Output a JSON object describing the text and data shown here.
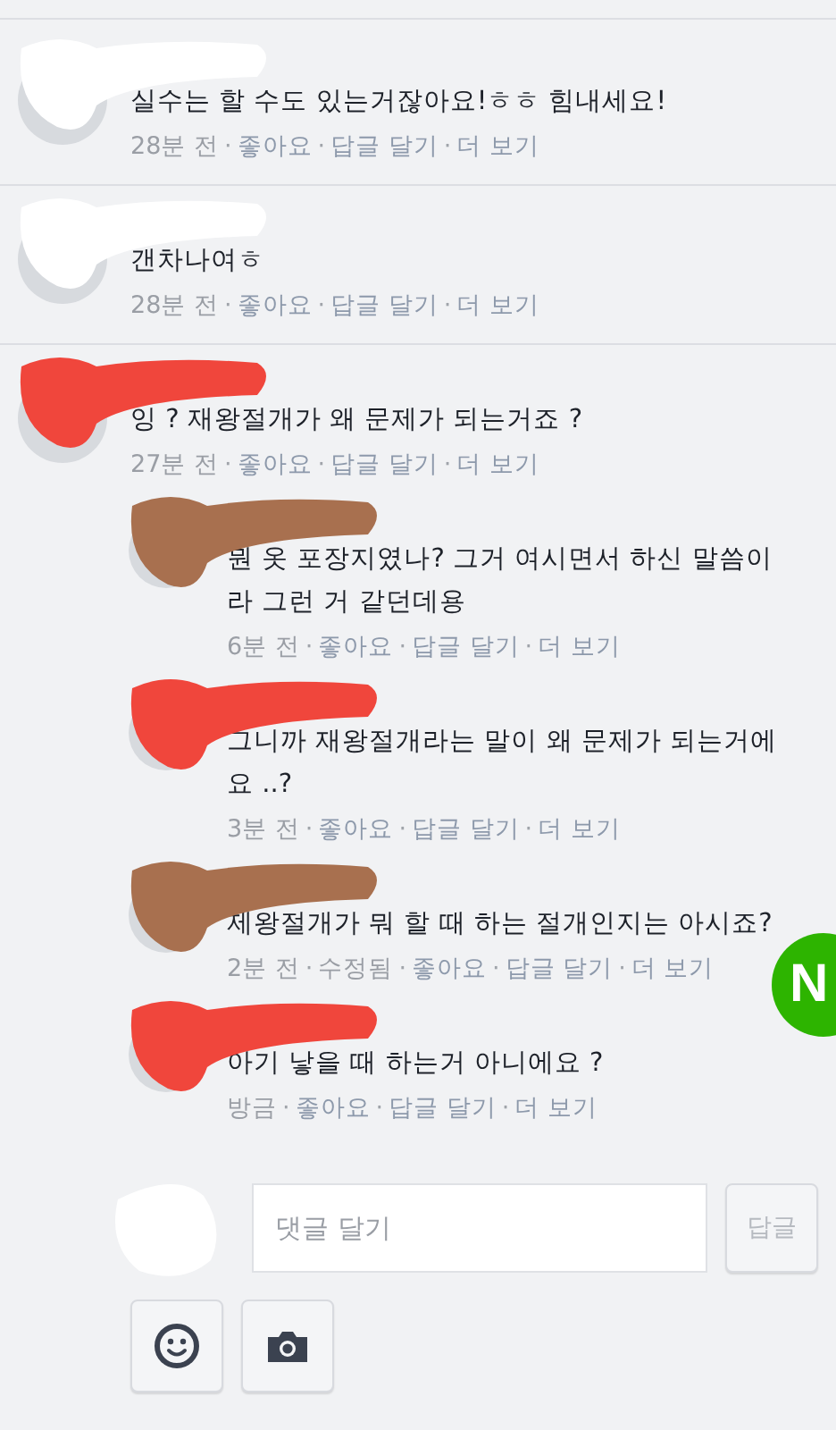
{
  "meta_separator": "·",
  "comments": [
    {
      "text": "실수는 할 수도 있는거잖아요!ㅎㅎ 힘내세요!",
      "color": "#ffffff",
      "meta": [
        {
          "kind": "time",
          "text": "28분 전"
        },
        {
          "kind": "link",
          "text": "좋아요"
        },
        {
          "kind": "link",
          "text": "답글 달기"
        },
        {
          "kind": "link",
          "text": "더 보기"
        }
      ]
    },
    {
      "text": "갠차나여ㅎ",
      "color": "#ffffff",
      "meta": [
        {
          "kind": "time",
          "text": "28분 전"
        },
        {
          "kind": "link",
          "text": "좋아요"
        },
        {
          "kind": "link",
          "text": "답글 달기"
        },
        {
          "kind": "link",
          "text": "더 보기"
        }
      ]
    },
    {
      "text": "잉 ? 재왕절개가 왜 문제가 되는거죠 ?",
      "color": "#f0463c",
      "meta": [
        {
          "kind": "time",
          "text": "27분 전"
        },
        {
          "kind": "link",
          "text": "좋아요"
        },
        {
          "kind": "link",
          "text": "답글 달기"
        },
        {
          "kind": "link",
          "text": "더 보기"
        }
      ],
      "replies": [
        {
          "text": "뭔 옷 포장지였나? 그거 여시면서 하신 말씀이라 그런 거 같던데용",
          "color": "#a8704f",
          "meta": [
            {
              "kind": "time",
              "text": "6분 전"
            },
            {
              "kind": "link",
              "text": "좋아요"
            },
            {
              "kind": "link",
              "text": "답글 달기"
            },
            {
              "kind": "link",
              "text": "더 보기"
            }
          ]
        },
        {
          "text": "그니까 재왕절개라는 말이 왜 문제가 되는거에요 ..?",
          "color": "#f0463c",
          "meta": [
            {
              "kind": "time",
              "text": "3분 전"
            },
            {
              "kind": "link",
              "text": "좋아요"
            },
            {
              "kind": "link",
              "text": "답글 달기"
            },
            {
              "kind": "link",
              "text": "더 보기"
            }
          ]
        },
        {
          "text": "제왕절개가 뭐 할 때 하는 절개인지는 아시죠?",
          "color": "#a8704f",
          "meta": [
            {
              "kind": "time",
              "text": "2분 전"
            },
            {
              "kind": "time",
              "text": "수정됨"
            },
            {
              "kind": "link",
              "text": "좋아요"
            },
            {
              "kind": "link",
              "text": "답글 달기"
            },
            {
              "kind": "link",
              "text": "더 보기"
            }
          ]
        },
        {
          "text": "아기 낳을 때 하는거 아니에요 ?",
          "color": "#f0463c",
          "meta": [
            {
              "kind": "time",
              "text": "방금"
            },
            {
              "kind": "link",
              "text": "좋아요"
            },
            {
              "kind": "link",
              "text": "답글 달기"
            },
            {
              "kind": "link",
              "text": "더 보기"
            }
          ]
        }
      ]
    }
  ],
  "composer": {
    "placeholder": "댓글 달기",
    "submit": "답글"
  },
  "floating_badge": {
    "text": "N"
  }
}
